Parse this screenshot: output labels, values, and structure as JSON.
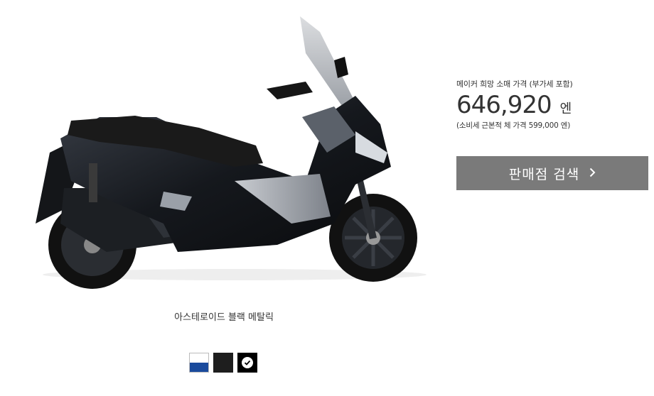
{
  "product": {
    "color_name": "아스테로이드 블랙 메탈릭"
  },
  "colors": [
    {
      "name": "white-blue",
      "selected": false
    },
    {
      "name": "black",
      "selected": false
    },
    {
      "name": "asteroid-black-metallic",
      "selected": true
    }
  ],
  "price": {
    "label": "메이커 희망 소매 가격 (부가세 포함)",
    "value": "646,920",
    "unit": "엔",
    "note": "(소비세 근본적 체 가격 599,000 엔)"
  },
  "dealer_button": {
    "label": "판매점 검색",
    "icon": "chevron-right-icon"
  }
}
